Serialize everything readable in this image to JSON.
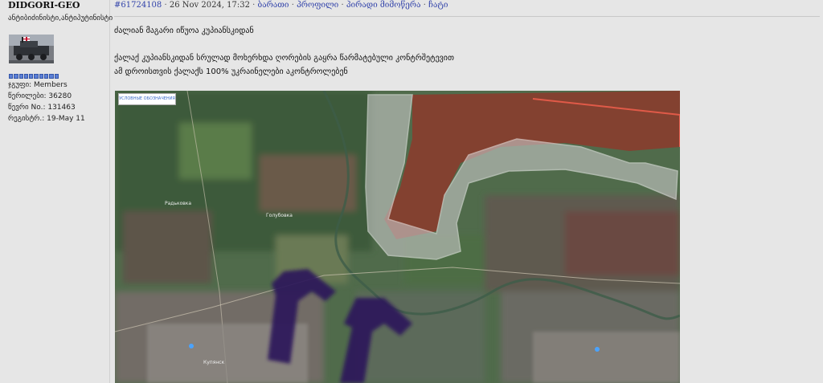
{
  "author": {
    "name": "DIDGORI-GEO",
    "title": "ანტიბიძინისტი,ანტიპუტინისტი",
    "group_label": "ჯგუფი: Members",
    "posts_label": "წერილები: 36280",
    "member_no_label": "წევრი No.: 131463",
    "registered_label": "რეგისტრ.: 19-May 11",
    "reputation_pips": 10,
    "avatar_icon": "military-vehicle-avatar"
  },
  "post": {
    "id": "#61724108",
    "date": "26 Nov 2024, 17:32",
    "separator": "·",
    "actions": {
      "report": "ბარათი",
      "profile": "პროფილი",
      "pm": "პირადი მიმოწერა",
      "quote": "ჩატი"
    },
    "lines": {
      "line1": "ძალიან მაგარი იწუოა კუპიანსკიდან",
      "line2": "ქალაქ კუპიანსკიდან სრულად მოხერხდა ღორების გაყრა წარმატებული კონტრშეტევით",
      "line3": "ამ დროისთვის ქალაქს 100% უკრაინელები აკონტროლებენ"
    },
    "map": {
      "legend_button": "УСЛОВНЫЕ ОБОЗНАЧЕНИЯ",
      "place_labels": {
        "radkovka": "Радьковка",
        "golubovka": "Голубовка",
        "kupyansk": "Купянск"
      },
      "colors": {
        "enemy_zone": "#8c3a2c",
        "gray_zone": "#c9c9c9",
        "arrow": "#2a1a5a",
        "link": "#3344aa"
      }
    }
  }
}
